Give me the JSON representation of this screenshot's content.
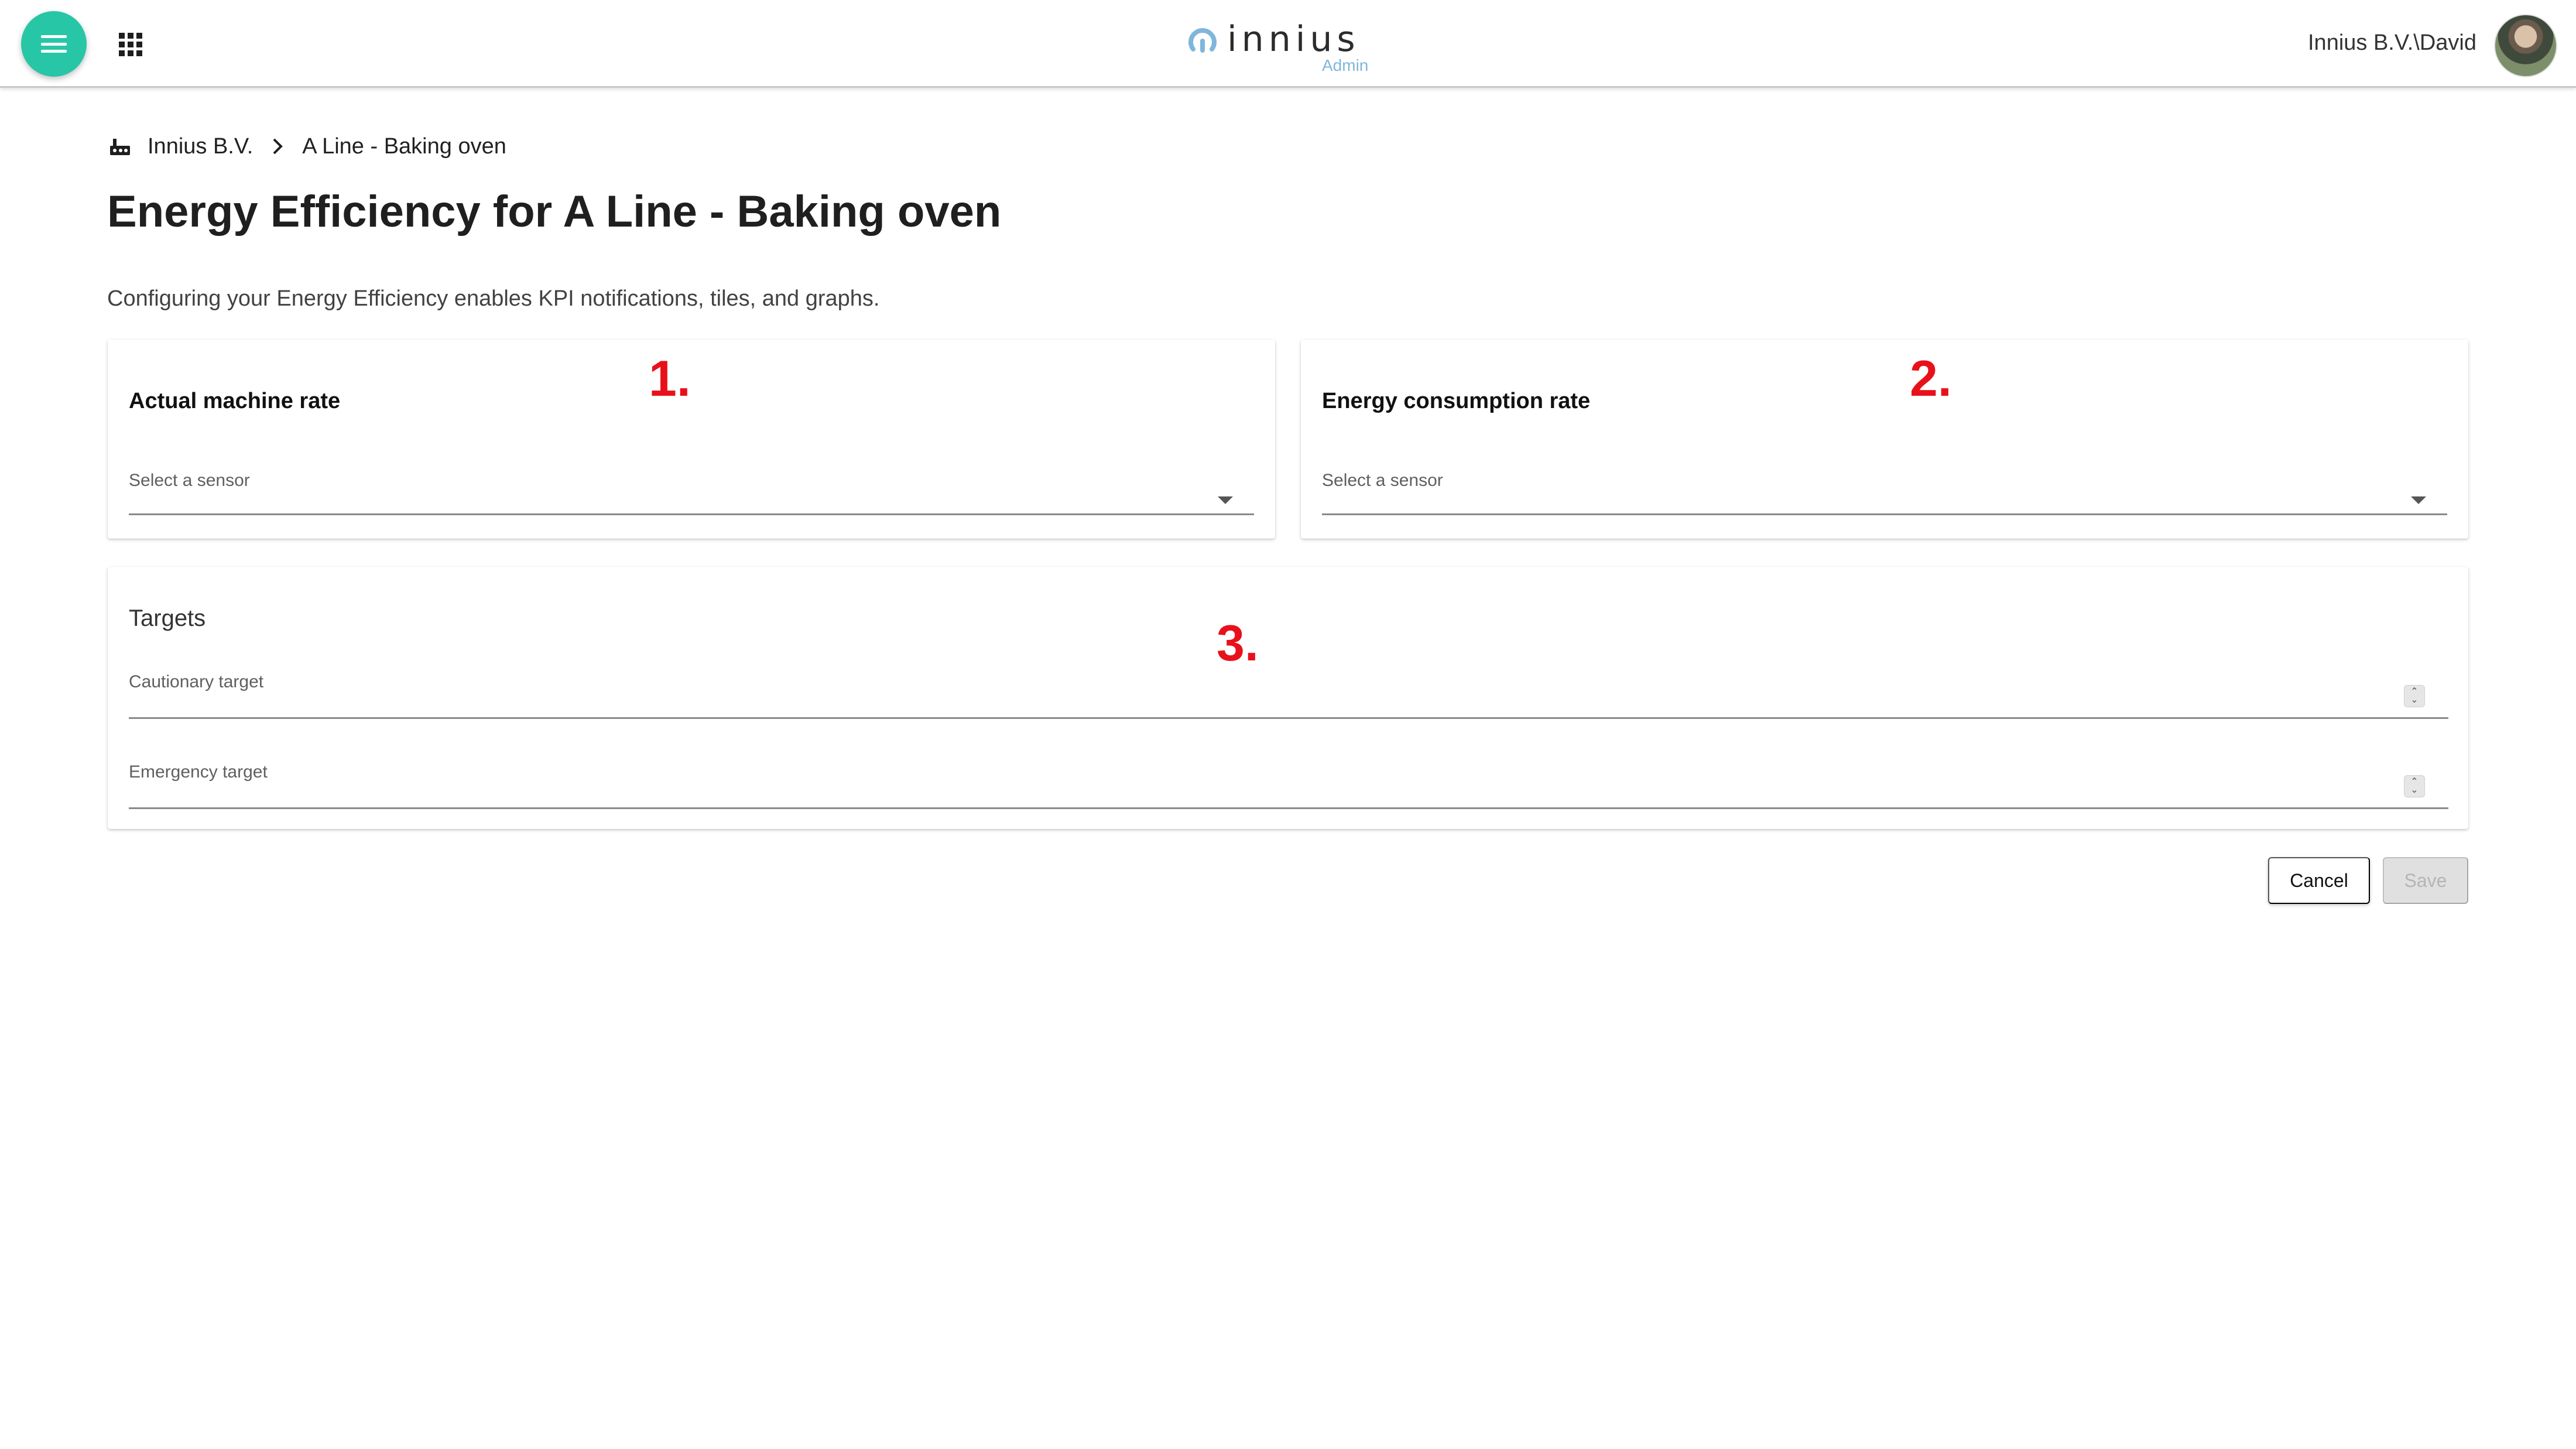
{
  "header": {
    "logo_text": "innius",
    "logo_subtext": "Admin",
    "user_name": "Innius B.V.\\David",
    "accent_color": "#26c6a6"
  },
  "breadcrumb": {
    "items": [
      "Innius B.V.",
      "A Line - Baking oven"
    ]
  },
  "page": {
    "title": "Energy Efficiency for A Line - Baking oven",
    "subtitle": "Configuring your Energy Efficiency enables KPI notifications, tiles, and graphs."
  },
  "cards": {
    "machine_rate": {
      "title": "Actual machine rate",
      "select_label": "Select a sensor",
      "annotation": "1."
    },
    "energy_rate": {
      "title": "Energy consumption rate",
      "select_label": "Select a sensor",
      "annotation": "2."
    },
    "targets": {
      "title": "Targets",
      "annotation": "3.",
      "cautionary_label": "Cautionary target",
      "emergency_label": "Emergency target"
    }
  },
  "actions": {
    "cancel_label": "Cancel",
    "save_label": "Save"
  },
  "icons": {
    "menu": "menu-icon",
    "apps": "apps-grid-icon",
    "home": "factory-icon",
    "chevron": "chevron-right-icon",
    "dropdown": "caret-down-icon",
    "spinner": "number-stepper-icon"
  }
}
